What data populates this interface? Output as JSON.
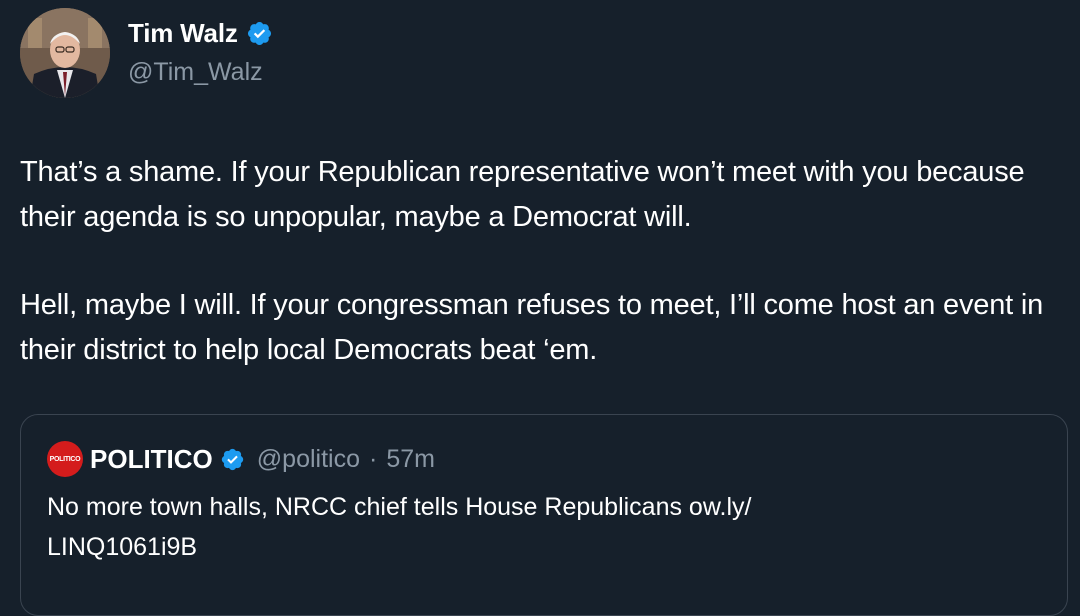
{
  "author": {
    "display_name": "Tim Walz",
    "handle": "@Tim_Walz",
    "avatar_icon": "profile-photo",
    "verified_icon": "verified-badge-icon"
  },
  "tweet": {
    "paragraphs": [
      "That’s a shame. If your Republican representative won’t meet with you because their agenda is so unpopular, maybe a Democrat will.",
      "Hell, maybe I will. If your congressman refuses to meet, I’ll come host an event in their district to help local Democrats beat ‘em."
    ]
  },
  "quoted_tweet": {
    "avatar_text": "POLITICO",
    "display_name": "POLITICO",
    "handle": "@politico",
    "separator": "·",
    "time": "57m",
    "text_line1": "No more town halls, NRCC chief tells House Republicans ow.ly/",
    "text_line2": "LINQ1061i9B"
  },
  "colors": {
    "background": "#16202b",
    "text": "#ffffff",
    "secondary_text": "#8b98a5",
    "verified_blue": "#1d9bf0",
    "quote_border": "#3a4450",
    "politico_red": "#d41c1c"
  }
}
